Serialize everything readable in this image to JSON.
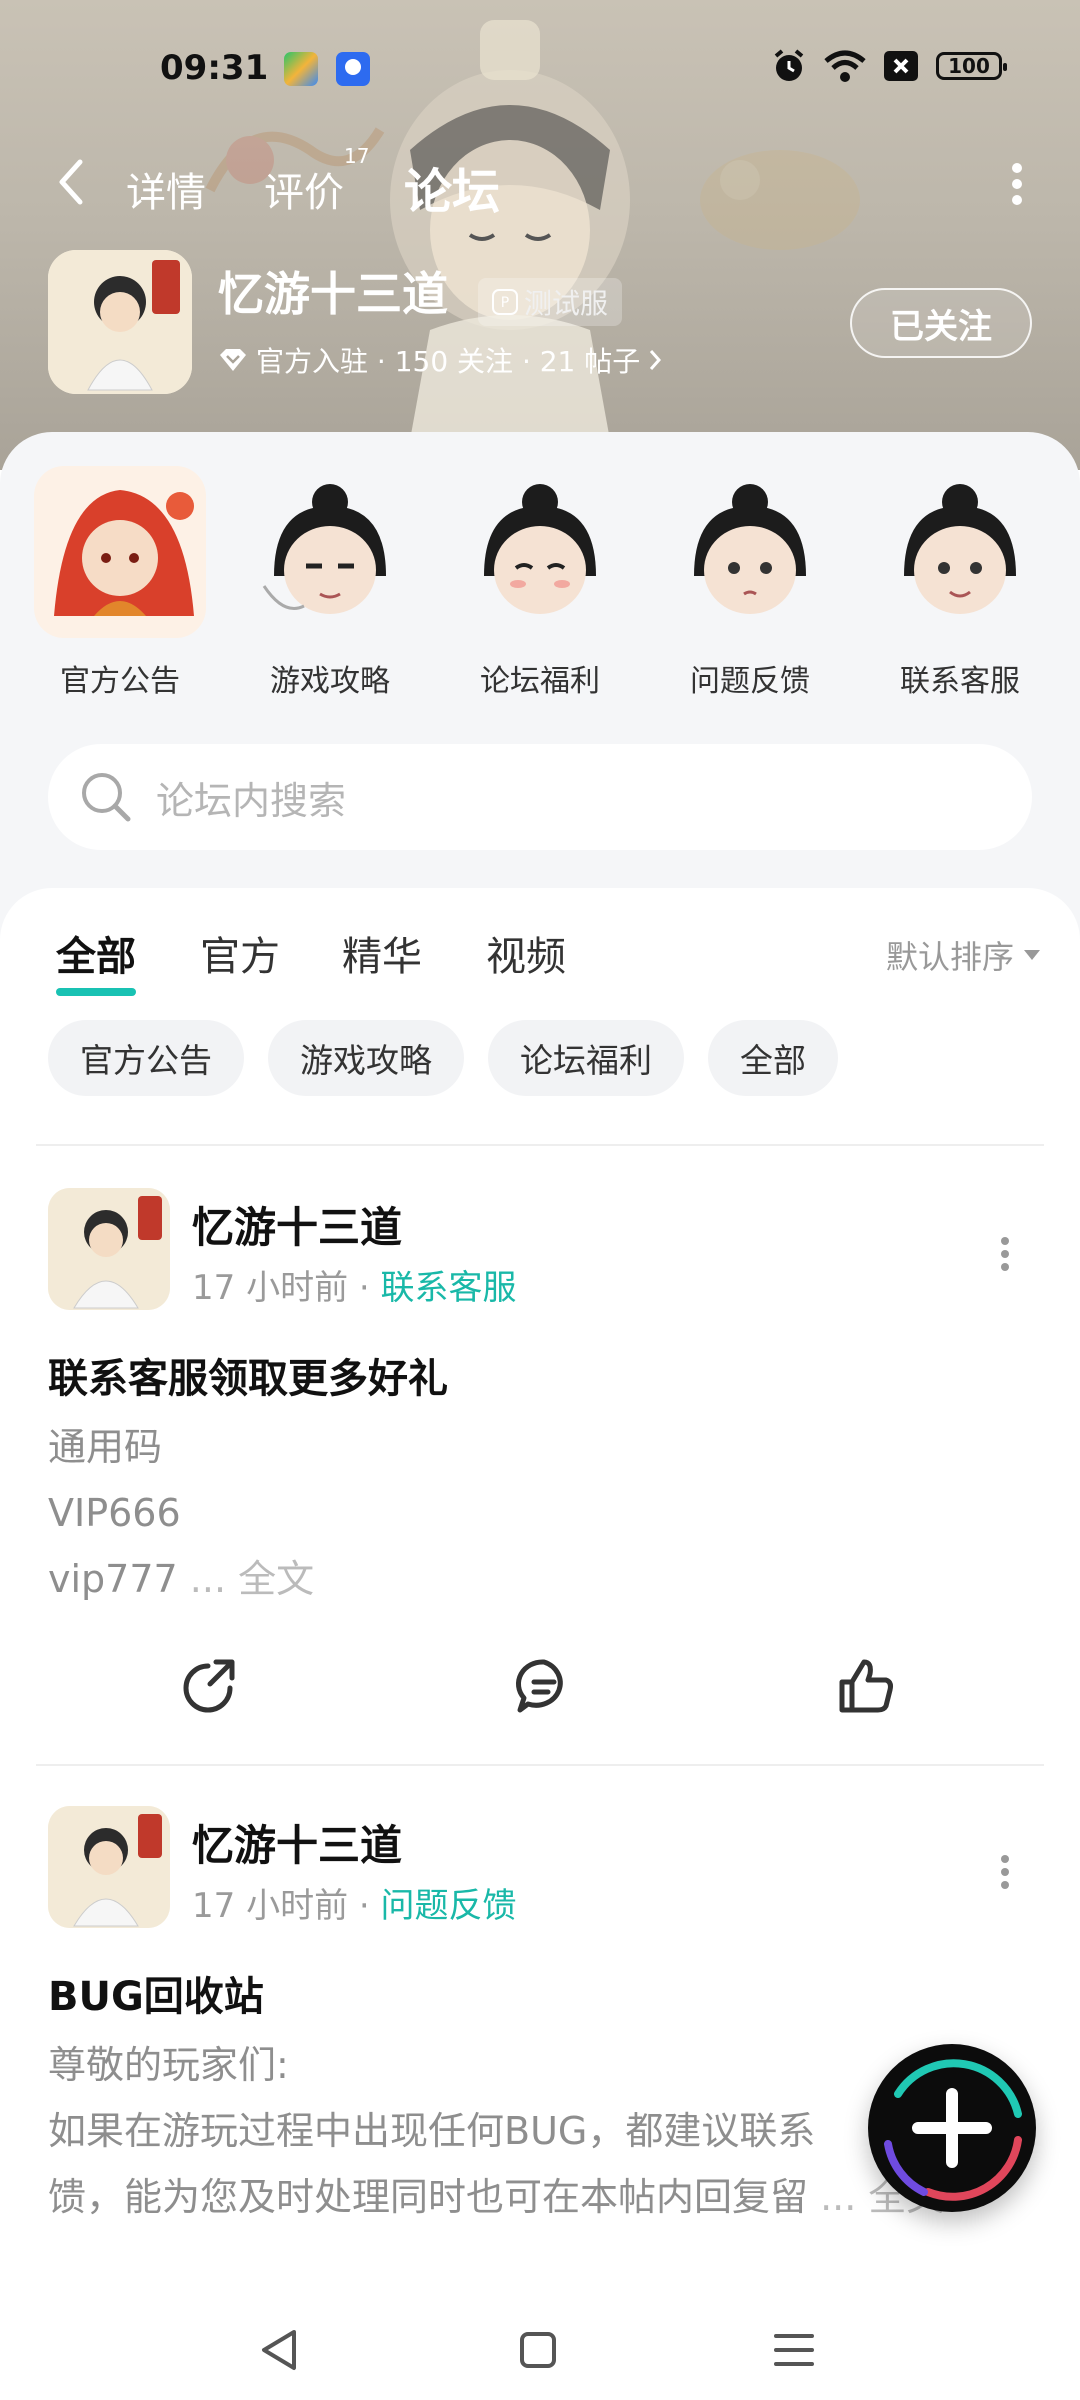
{
  "status_bar": {
    "time": "09:31",
    "battery": "100",
    "icons": [
      "alarm-icon",
      "wifi-icon",
      "sim-off-icon",
      "battery-icon"
    ]
  },
  "nav": {
    "tabs": [
      {
        "label": "详情"
      },
      {
        "label": "评价",
        "badge": "17"
      },
      {
        "label": "论坛"
      }
    ],
    "active_tab": "论坛"
  },
  "game": {
    "name": "忆游十三道",
    "badge": "测试服",
    "meta": "官方入驻 · 150 关注 · 21 帖子",
    "follow_label": "已关注"
  },
  "shortcuts": [
    {
      "label": "官方公告"
    },
    {
      "label": "游戏攻略"
    },
    {
      "label": "论坛福利"
    },
    {
      "label": "问题反馈"
    },
    {
      "label": "联系客服"
    }
  ],
  "search": {
    "placeholder": "论坛内搜索"
  },
  "feed": {
    "tabs": [
      "全部",
      "官方",
      "精华",
      "视频"
    ],
    "active_tab": "全部",
    "sort_label": "默认排序",
    "chips": [
      "官方公告",
      "游戏攻略",
      "论坛福利",
      "全部"
    ]
  },
  "posts": [
    {
      "author": "忆游十三道",
      "time": "17 小时前",
      "sep": "·",
      "category": "联系客服",
      "title": "联系客服领取更多好礼",
      "lines": [
        "通用码",
        "VIP666",
        "vip777"
      ],
      "ellipsis": " ... ",
      "more": "全文"
    },
    {
      "author": "忆游十三道",
      "time": "17 小时前",
      "sep": "·",
      "category": "问题反馈",
      "title": "BUG回收站",
      "lines": [
        "尊敬的玩家们:",
        " 如果在游玩过程中出现任何BUG，都建议联系",
        "馈，能为您及时处理同时也可在本帖内回复留"
      ],
      "ellipsis": " ... ",
      "more": "全文"
    }
  ],
  "colors": {
    "accent": "#19c2b3",
    "category": "#19b8a8",
    "panel_bg": "#f5f6f8"
  }
}
